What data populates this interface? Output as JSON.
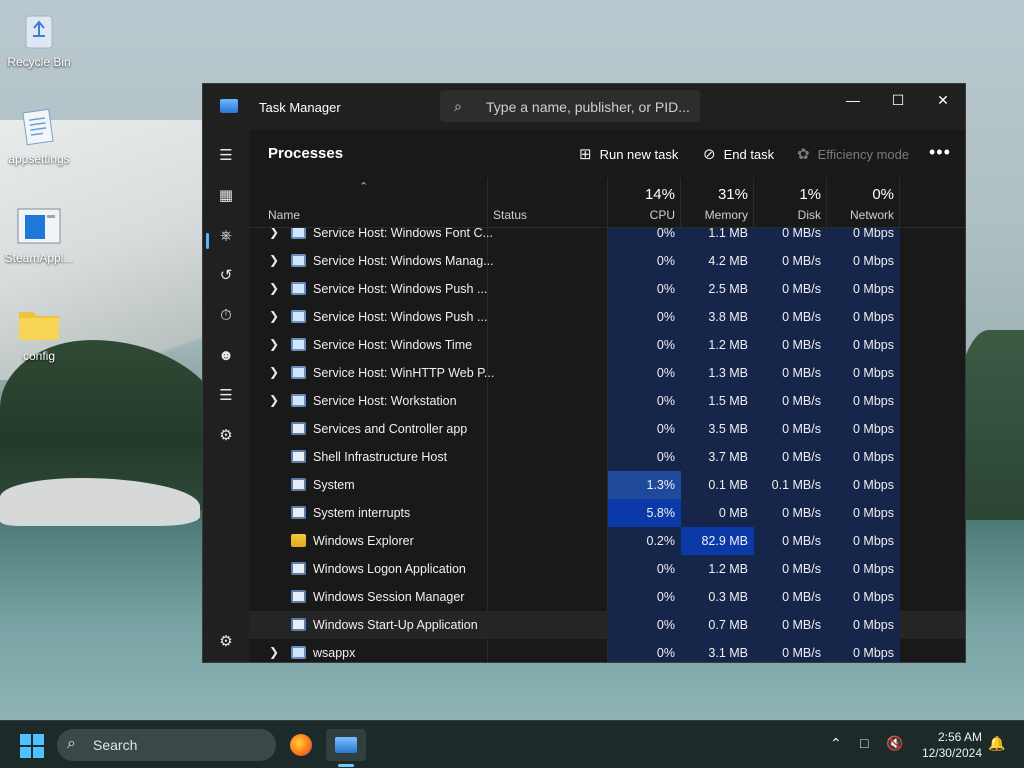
{
  "desktop": {
    "icons": [
      {
        "label": "Recycle Bin",
        "icon": "recycle-bin-icon"
      },
      {
        "label": "appsettings",
        "icon": "notepad-document-icon"
      },
      {
        "label": "SteamAppl...",
        "icon": "app-window-icon"
      },
      {
        "label": "config",
        "icon": "folder-icon"
      }
    ]
  },
  "window": {
    "title": "Task Manager",
    "search_placeholder": "Type a name, publisher, or PID...",
    "controls": {
      "minimize": "—",
      "maximize": "☐",
      "close": "✕"
    }
  },
  "nav": {
    "items": [
      "hamburger-menu-icon",
      "processes-icon",
      "performance-icon",
      "app-history-icon",
      "startup-apps-icon",
      "users-icon",
      "details-icon",
      "services-icon",
      "settings-icon"
    ],
    "active": "processes-icon"
  },
  "toolbar": {
    "heading": "Processes",
    "run_new_task": "Run new task",
    "end_task": "End task",
    "efficiency_mode": "Efficiency mode",
    "more": "•••"
  },
  "columns": {
    "name": "Name",
    "status": "Status",
    "cpu": {
      "pct": "14%",
      "label": "CPU"
    },
    "memory": {
      "pct": "31%",
      "label": "Memory"
    },
    "disk": {
      "pct": "1%",
      "label": "Disk"
    },
    "network": {
      "pct": "0%",
      "label": "Network"
    }
  },
  "rows": [
    {
      "expand": true,
      "icon": "gear",
      "name": "Service Host: Windows Font C...",
      "cpu": "0%",
      "mem": "1.1 MB",
      "disk": "0 MB/s",
      "net": "0 Mbps"
    },
    {
      "expand": true,
      "icon": "gear",
      "name": "Service Host: Windows Manag...",
      "cpu": "0%",
      "mem": "4.2 MB",
      "disk": "0 MB/s",
      "net": "0 Mbps"
    },
    {
      "expand": true,
      "icon": "gear",
      "name": "Service Host: Windows Push ...",
      "cpu": "0%",
      "mem": "2.5 MB",
      "disk": "0 MB/s",
      "net": "0 Mbps"
    },
    {
      "expand": true,
      "icon": "gear",
      "name": "Service Host: Windows Push ...",
      "cpu": "0%",
      "mem": "3.8 MB",
      "disk": "0 MB/s",
      "net": "0 Mbps"
    },
    {
      "expand": true,
      "icon": "gear",
      "name": "Service Host: Windows Time",
      "cpu": "0%",
      "mem": "1.2 MB",
      "disk": "0 MB/s",
      "net": "0 Mbps"
    },
    {
      "expand": true,
      "icon": "gear",
      "name": "Service Host: WinHTTP Web P...",
      "cpu": "0%",
      "mem": "1.3 MB",
      "disk": "0 MB/s",
      "net": "0 Mbps"
    },
    {
      "expand": true,
      "icon": "gear",
      "name": "Service Host: Workstation",
      "cpu": "0%",
      "mem": "1.5 MB",
      "disk": "0 MB/s",
      "net": "0 Mbps"
    },
    {
      "expand": false,
      "icon": "app",
      "name": "Services and Controller app",
      "cpu": "0%",
      "mem": "3.5 MB",
      "disk": "0 MB/s",
      "net": "0 Mbps"
    },
    {
      "expand": false,
      "icon": "app",
      "name": "Shell Infrastructure Host",
      "cpu": "0%",
      "mem": "3.7 MB",
      "disk": "0 MB/s",
      "net": "0 Mbps"
    },
    {
      "expand": false,
      "icon": "app",
      "name": "System",
      "cpu": "1.3%",
      "mem": "0.1 MB",
      "disk": "0.1 MB/s",
      "net": "0 Mbps"
    },
    {
      "expand": false,
      "icon": "app",
      "name": "System interrupts",
      "cpu": "5.8%",
      "mem": "0 MB",
      "disk": "0 MB/s",
      "net": "0 Mbps"
    },
    {
      "expand": false,
      "icon": "folder",
      "name": "Windows Explorer",
      "cpu": "0.2%",
      "mem": "82.9 MB",
      "disk": "0 MB/s",
      "net": "0 Mbps"
    },
    {
      "expand": false,
      "icon": "app",
      "name": "Windows Logon Application",
      "cpu": "0%",
      "mem": "1.2 MB",
      "disk": "0 MB/s",
      "net": "0 Mbps"
    },
    {
      "expand": false,
      "icon": "app",
      "name": "Windows Session Manager",
      "cpu": "0%",
      "mem": "0.3 MB",
      "disk": "0 MB/s",
      "net": "0 Mbps"
    },
    {
      "expand": false,
      "icon": "app",
      "name": "Windows Start-Up Application",
      "cpu": "0%",
      "mem": "0.7 MB",
      "disk": "0 MB/s",
      "net": "0 Mbps",
      "hover": true
    },
    {
      "expand": true,
      "icon": "gear",
      "name": "wsappx",
      "cpu": "0%",
      "mem": "3.1 MB",
      "disk": "0 MB/s",
      "net": "0 Mbps"
    }
  ],
  "heat_colors": {
    "base": "#16264a",
    "light": "#1b3a78",
    "medium": "#1f4a9c",
    "strong": "#0b3aa8"
  },
  "taskbar": {
    "search_label": "Search",
    "apps": [
      "firefox-icon",
      "task-manager-icon"
    ],
    "time": "2:56 AM",
    "date": "12/30/2024"
  }
}
